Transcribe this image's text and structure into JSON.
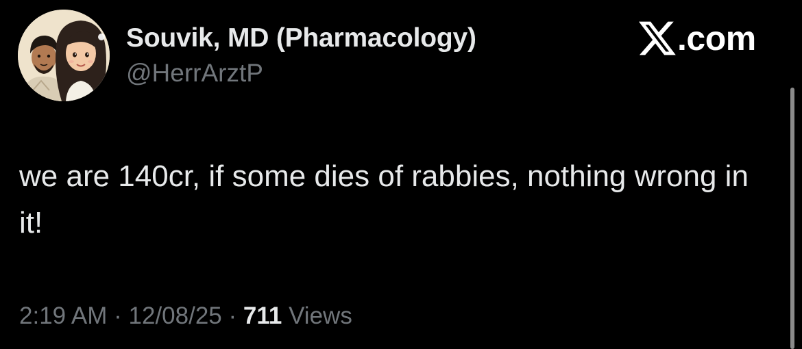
{
  "author": {
    "name": "Souvik, MD (Pharmacology)",
    "handle": "@HerrArztP",
    "avatar_icon": "couple-cartoon-avatar"
  },
  "brand": {
    "logo_icon": "x-logo-icon",
    "text": ".com"
  },
  "tweet": {
    "text": "we are 140cr, if some dies of rabbies, nothing wrong in it!"
  },
  "meta": {
    "time": "2:19 AM",
    "separator_1": " · ",
    "date": "12/08/25",
    "separator_2": " · ",
    "views_count": "711",
    "views_label": " Views"
  },
  "colors": {
    "background": "#000000",
    "primary_text": "#e7e9ea",
    "secondary_text": "#71767b"
  }
}
